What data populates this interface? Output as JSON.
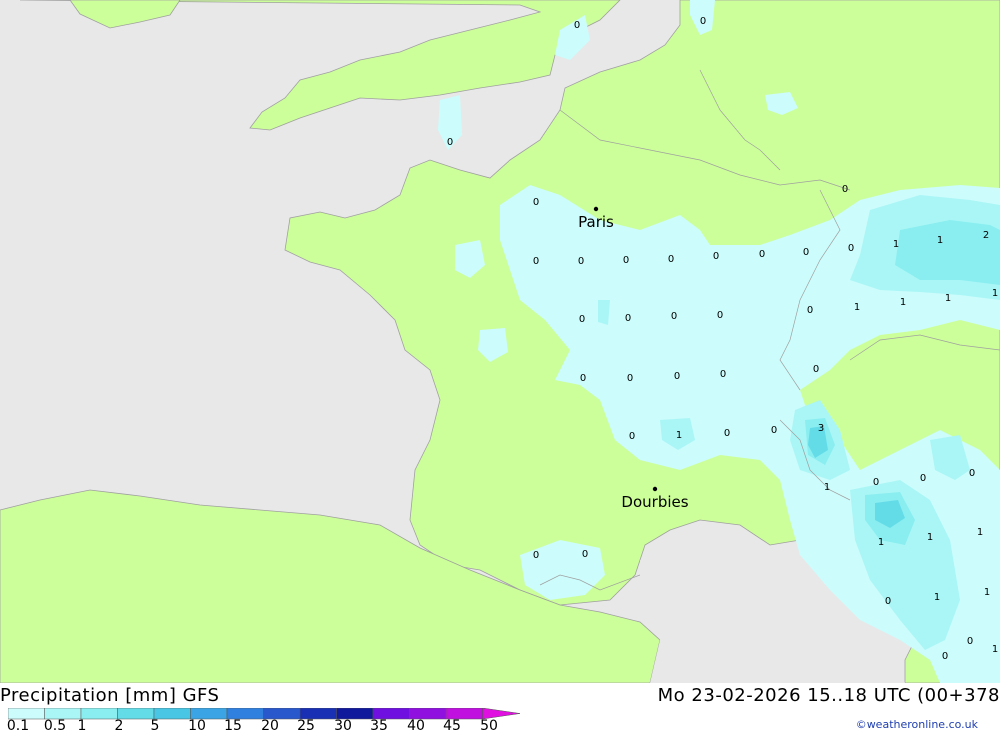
{
  "title_left": "Precipitation [mm] GFS",
  "title_right": "Mo 23-02-2026 15..18 UTC (00+378",
  "credit": "©weatheronline.co.uk",
  "colors": {
    "sea": "#e8e8e8",
    "land": "#ccff99",
    "border": "#a0a0a0"
  },
  "legend": {
    "ticks": [
      "0.1",
      "0.5",
      "1",
      "2",
      "5",
      "10",
      "15",
      "20",
      "25",
      "30",
      "35",
      "40",
      "45",
      "50"
    ],
    "colors": [
      "#ccfcfc",
      "#aaf6f6",
      "#8aeef0",
      "#64dce8",
      "#48c6e4",
      "#3aa4e4",
      "#3080e0",
      "#2858cc",
      "#1a30b4",
      "#10189c",
      "#7010e0",
      "#9010e0",
      "#c010e0",
      "#e010e0",
      "#c0109c"
    ]
  },
  "cities": [
    {
      "name": "Paris"
    },
    {
      "name": "Dourbies"
    }
  ],
  "values": [
    "0",
    "0",
    "0",
    "0",
    "0",
    "0",
    "0",
    "0",
    "0",
    "0",
    "0",
    "0",
    "0",
    "0",
    "1",
    "1",
    "2",
    "1",
    "1",
    "1",
    "1",
    "0",
    "0",
    "0",
    "0",
    "0",
    "0",
    "0",
    "0",
    "0",
    "0",
    "1",
    "0",
    "0",
    "3",
    "1",
    "0",
    "0",
    "0",
    "1",
    "1",
    "1",
    "0",
    "0",
    "0",
    "0",
    "1",
    "1",
    "0",
    "1"
  ]
}
